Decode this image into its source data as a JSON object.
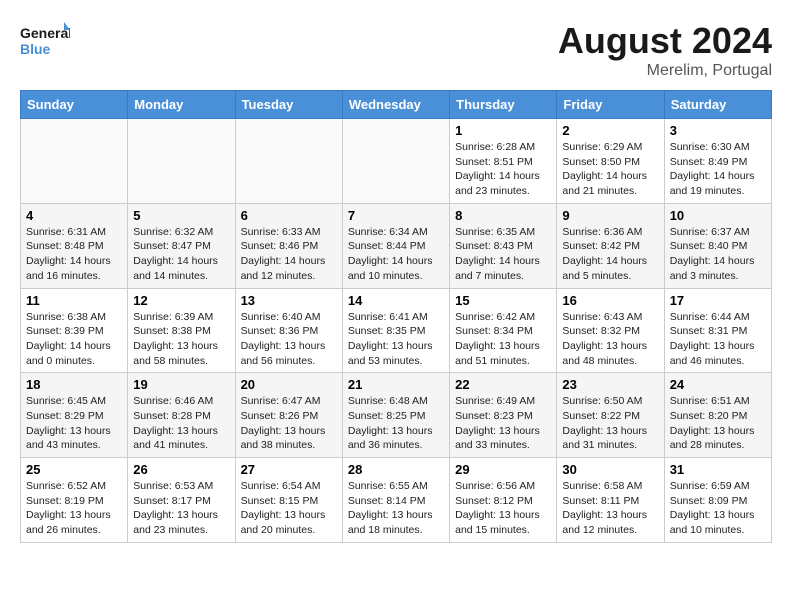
{
  "header": {
    "logo_line1": "General",
    "logo_line2": "Blue",
    "month_year": "August 2024",
    "location": "Merelim, Portugal"
  },
  "days_of_week": [
    "Sunday",
    "Monday",
    "Tuesday",
    "Wednesday",
    "Thursday",
    "Friday",
    "Saturday"
  ],
  "weeks": [
    [
      {
        "day": "",
        "content": ""
      },
      {
        "day": "",
        "content": ""
      },
      {
        "day": "",
        "content": ""
      },
      {
        "day": "",
        "content": ""
      },
      {
        "day": "1",
        "content": "Sunrise: 6:28 AM\nSunset: 8:51 PM\nDaylight: 14 hours and 23 minutes."
      },
      {
        "day": "2",
        "content": "Sunrise: 6:29 AM\nSunset: 8:50 PM\nDaylight: 14 hours and 21 minutes."
      },
      {
        "day": "3",
        "content": "Sunrise: 6:30 AM\nSunset: 8:49 PM\nDaylight: 14 hours and 19 minutes."
      }
    ],
    [
      {
        "day": "4",
        "content": "Sunrise: 6:31 AM\nSunset: 8:48 PM\nDaylight: 14 hours and 16 minutes."
      },
      {
        "day": "5",
        "content": "Sunrise: 6:32 AM\nSunset: 8:47 PM\nDaylight: 14 hours and 14 minutes."
      },
      {
        "day": "6",
        "content": "Sunrise: 6:33 AM\nSunset: 8:46 PM\nDaylight: 14 hours and 12 minutes."
      },
      {
        "day": "7",
        "content": "Sunrise: 6:34 AM\nSunset: 8:44 PM\nDaylight: 14 hours and 10 minutes."
      },
      {
        "day": "8",
        "content": "Sunrise: 6:35 AM\nSunset: 8:43 PM\nDaylight: 14 hours and 7 minutes."
      },
      {
        "day": "9",
        "content": "Sunrise: 6:36 AM\nSunset: 8:42 PM\nDaylight: 14 hours and 5 minutes."
      },
      {
        "day": "10",
        "content": "Sunrise: 6:37 AM\nSunset: 8:40 PM\nDaylight: 14 hours and 3 minutes."
      }
    ],
    [
      {
        "day": "11",
        "content": "Sunrise: 6:38 AM\nSunset: 8:39 PM\nDaylight: 14 hours and 0 minutes."
      },
      {
        "day": "12",
        "content": "Sunrise: 6:39 AM\nSunset: 8:38 PM\nDaylight: 13 hours and 58 minutes."
      },
      {
        "day": "13",
        "content": "Sunrise: 6:40 AM\nSunset: 8:36 PM\nDaylight: 13 hours and 56 minutes."
      },
      {
        "day": "14",
        "content": "Sunrise: 6:41 AM\nSunset: 8:35 PM\nDaylight: 13 hours and 53 minutes."
      },
      {
        "day": "15",
        "content": "Sunrise: 6:42 AM\nSunset: 8:34 PM\nDaylight: 13 hours and 51 minutes."
      },
      {
        "day": "16",
        "content": "Sunrise: 6:43 AM\nSunset: 8:32 PM\nDaylight: 13 hours and 48 minutes."
      },
      {
        "day": "17",
        "content": "Sunrise: 6:44 AM\nSunset: 8:31 PM\nDaylight: 13 hours and 46 minutes."
      }
    ],
    [
      {
        "day": "18",
        "content": "Sunrise: 6:45 AM\nSunset: 8:29 PM\nDaylight: 13 hours and 43 minutes."
      },
      {
        "day": "19",
        "content": "Sunrise: 6:46 AM\nSunset: 8:28 PM\nDaylight: 13 hours and 41 minutes."
      },
      {
        "day": "20",
        "content": "Sunrise: 6:47 AM\nSunset: 8:26 PM\nDaylight: 13 hours and 38 minutes."
      },
      {
        "day": "21",
        "content": "Sunrise: 6:48 AM\nSunset: 8:25 PM\nDaylight: 13 hours and 36 minutes."
      },
      {
        "day": "22",
        "content": "Sunrise: 6:49 AM\nSunset: 8:23 PM\nDaylight: 13 hours and 33 minutes."
      },
      {
        "day": "23",
        "content": "Sunrise: 6:50 AM\nSunset: 8:22 PM\nDaylight: 13 hours and 31 minutes."
      },
      {
        "day": "24",
        "content": "Sunrise: 6:51 AM\nSunset: 8:20 PM\nDaylight: 13 hours and 28 minutes."
      }
    ],
    [
      {
        "day": "25",
        "content": "Sunrise: 6:52 AM\nSunset: 8:19 PM\nDaylight: 13 hours and 26 minutes."
      },
      {
        "day": "26",
        "content": "Sunrise: 6:53 AM\nSunset: 8:17 PM\nDaylight: 13 hours and 23 minutes."
      },
      {
        "day": "27",
        "content": "Sunrise: 6:54 AM\nSunset: 8:15 PM\nDaylight: 13 hours and 20 minutes."
      },
      {
        "day": "28",
        "content": "Sunrise: 6:55 AM\nSunset: 8:14 PM\nDaylight: 13 hours and 18 minutes."
      },
      {
        "day": "29",
        "content": "Sunrise: 6:56 AM\nSunset: 8:12 PM\nDaylight: 13 hours and 15 minutes."
      },
      {
        "day": "30",
        "content": "Sunrise: 6:58 AM\nSunset: 8:11 PM\nDaylight: 13 hours and 12 minutes."
      },
      {
        "day": "31",
        "content": "Sunrise: 6:59 AM\nSunset: 8:09 PM\nDaylight: 13 hours and 10 minutes."
      }
    ]
  ]
}
